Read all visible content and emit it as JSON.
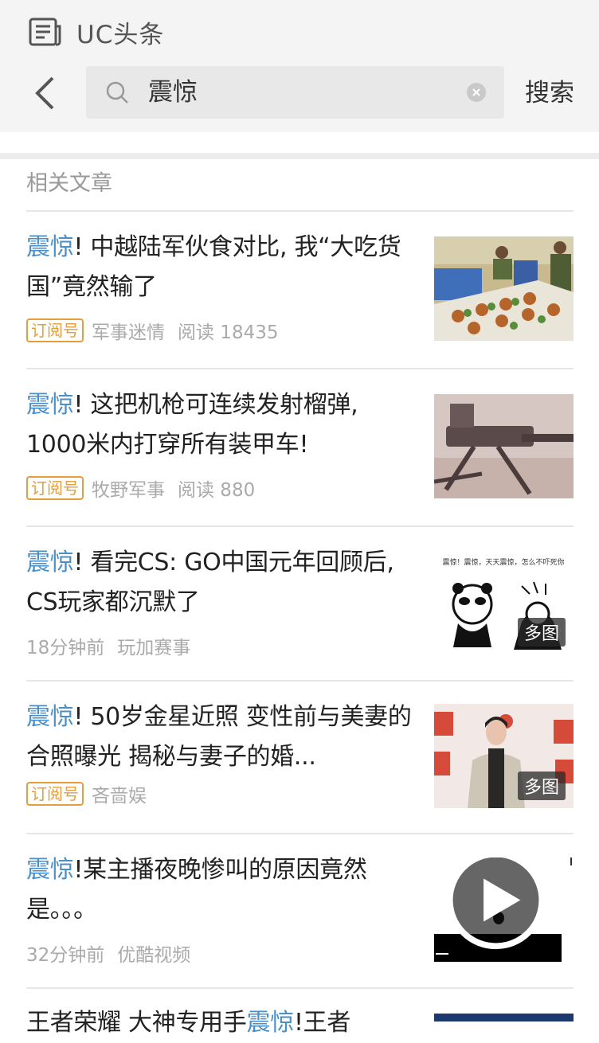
{
  "header": {
    "app_title": "UC头条",
    "search_value": "震惊",
    "search_button": "搜索"
  },
  "section": {
    "title": "相关文章"
  },
  "articles": [
    {
      "keyword": "震惊",
      "title_rest": "! 中越陆军伙食对比, 我“大吃货国”竟然输了",
      "tag": "订阅号",
      "source": "军事迷情",
      "reads": "阅读 18435"
    },
    {
      "keyword": "震惊",
      "title_rest": "! 这把机枪可连续发射榴弹, 1000米内打穿所有装甲车!",
      "tag": "订阅号",
      "source": "牧野军事",
      "reads": "阅读 880"
    },
    {
      "keyword": "震惊",
      "title_rest": "! 看完CS: GO中国元年回顾后, CS玩家都沉默了",
      "time": "18分钟前",
      "source": "玩加赛事",
      "badge": "多图",
      "thumb_caption": "震惊！震惊，天天震惊，怎么不吓死你"
    },
    {
      "keyword": "震惊",
      "title_rest": "! 50岁金星近照 变性前与美妻的合照曝光 揭秘与妻子的婚...",
      "tag": "订阅号",
      "source": "吝啬娱",
      "badge": "多图"
    },
    {
      "keyword": "震惊",
      "title_rest": "!某主播夜晚惨叫的原因竟然是。。。",
      "time": "32分钟前",
      "source": "优酷视频"
    },
    {
      "title_start": "王者荣耀 大神专用手",
      "keyword": "震惊",
      "title_rest": "!王者"
    }
  ]
}
